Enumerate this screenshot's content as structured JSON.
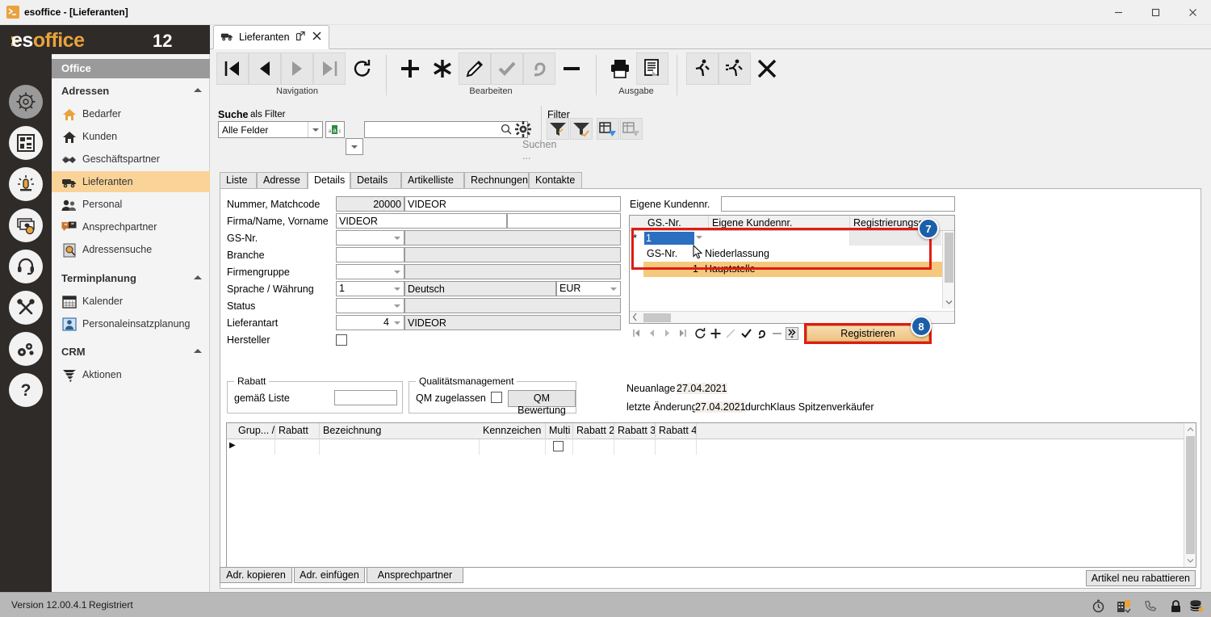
{
  "window": {
    "title": "esoffice - [Lieferanten]",
    "minimize": "minimize-icon",
    "maximize": "maximize-icon",
    "close": "close-icon"
  },
  "brand": {
    "name_es": "es",
    "name_office": "office",
    "version": "12"
  },
  "sidebar": {
    "header": "Office",
    "rail_icons": [
      "compass-icon",
      "layout-icon",
      "alarm-icon",
      "money-icon",
      "headset-icon",
      "tools-icon",
      "gears-icon",
      "help-icon"
    ],
    "groups": [
      {
        "label": "Adressen",
        "items": [
          {
            "label": "Bedarfer",
            "icon": "house-orange-icon"
          },
          {
            "label": "Kunden",
            "icon": "house-dark-icon"
          },
          {
            "label": "Geschäftspartner",
            "icon": "handshake-icon"
          },
          {
            "label": "Lieferanten",
            "icon": "truck-icon",
            "active": true
          },
          {
            "label": "Personal",
            "icon": "people-icon"
          },
          {
            "label": "Ansprechpartner",
            "icon": "quote-icon"
          },
          {
            "label": "Adressensuche",
            "icon": "address-search-icon"
          }
        ]
      },
      {
        "label": "Terminplanung",
        "items": [
          {
            "label": "Kalender",
            "icon": "calendar-icon"
          },
          {
            "label": "Personaleinsatzplanung",
            "icon": "staff-planning-icon"
          }
        ]
      },
      {
        "label": "CRM",
        "items": [
          {
            "label": "Aktionen",
            "icon": "tornado-icon"
          }
        ]
      }
    ]
  },
  "doc_tab": {
    "label": "Lieferanten",
    "icon": "truck-icon",
    "detach_icon": "popout-icon",
    "close_icon": "close-icon"
  },
  "toolbar": {
    "groups": [
      {
        "label": "Navigation",
        "buttons": [
          "first-record-icon",
          "prev-record-icon",
          "next-record-icon",
          "last-record-icon",
          "refresh-icon"
        ]
      },
      {
        "label": "Bearbeiten",
        "buttons": [
          "add-icon",
          "new-icon",
          "edit-icon",
          "confirm-icon",
          "undo-icon",
          "delete-icon"
        ]
      },
      {
        "label": "Ausgabe",
        "buttons": [
          "print-icon",
          "report-icon"
        ]
      },
      {
        "label": "",
        "buttons": [
          "run-icon",
          "run-fast-icon",
          "cancel-icon"
        ]
      }
    ]
  },
  "search": {
    "label": "Suche",
    "sublabel": "als Filter",
    "field_selector": "Alle Felder",
    "mode_icon": "abc-icon",
    "input_placeholder": "Suchen ...",
    "input_value": "",
    "search_icon": "search-icon",
    "settings_icon": "gear-icon"
  },
  "filter": {
    "label": "Filter",
    "buttons": [
      "filter-icon",
      "filter-check-icon",
      "filter-grid-icon",
      "filter-grid-off-icon"
    ]
  },
  "page_tabs": [
    {
      "label": "Liste",
      "active": false
    },
    {
      "label": "Adresse",
      "active": false
    },
    {
      "label": "Details",
      "active": true
    },
    {
      "label": "Details II",
      "active": false
    },
    {
      "label": "Artikelliste",
      "active": false
    },
    {
      "label": "Rechnungen",
      "active": false
    },
    {
      "label": "Kontakte",
      "active": false
    }
  ],
  "details_form": {
    "fields": [
      {
        "label": "Nummer, Matchcode",
        "value1": "20000",
        "value2": "VIDEOR"
      },
      {
        "label": "Firma/Name, Vorname",
        "value1": "VIDEOR",
        "value2": ""
      },
      {
        "label": "GS-Nr.",
        "value1": "",
        "value2": ""
      },
      {
        "label": "Branche",
        "value1": "",
        "value2": ""
      },
      {
        "label": "Firmengruppe",
        "value1": "",
        "value2": ""
      },
      {
        "label": "Sprache / Währung",
        "value1": "1",
        "value2": "Deutsch",
        "value3": "EUR"
      },
      {
        "label": "Status",
        "value1": "",
        "value2": ""
      },
      {
        "label": "Lieferantart",
        "value1": "4",
        "value2": "VIDEOR"
      },
      {
        "label": "Hersteller",
        "checkbox": true,
        "checked": false
      }
    ]
  },
  "customer_number_panel": {
    "label": "Eigene Kundennr.",
    "input_value": "",
    "columns": [
      "GS.-Nr.",
      "Eigene Kundennr.",
      "Registrierungssta"
    ],
    "editing_row": {
      "marker": "*",
      "gs_nr": "1",
      "kundennr": "",
      "status": ""
    },
    "dropdown": {
      "columns": [
        "GS-Nr.",
        "Niederlassung"
      ],
      "rows": [
        {
          "gs_nr": "1",
          "niederlassung": "Hauptstelle",
          "selected": true
        }
      ]
    },
    "nav_buttons": [
      "first-icon",
      "prev-icon",
      "next-icon",
      "last-icon",
      "refresh-icon",
      "add-icon",
      "edit-icon",
      "accept-icon",
      "undo-icon",
      "delete-icon",
      "more-icon"
    ],
    "register_button": "Registrieren",
    "callout_grid": "7",
    "callout_register": "8"
  },
  "rabatt_group": {
    "title": "Rabatt",
    "label": "gemäß Liste",
    "value": ""
  },
  "qm_group": {
    "title": "Qualitätsmanagement",
    "checkbox_label": "QM zugelassen",
    "checked": false,
    "button": "QM Bewertung"
  },
  "meta": {
    "created_label": "Neuanlage",
    "created_date": "27.04.2021",
    "changed_label": "letzte Änderung",
    "changed_date": "27.04.2021",
    "changed_by_label": "durch",
    "changed_by": "Klaus Spitzenverkäufer"
  },
  "discount_table": {
    "columns": [
      "Grup... /",
      "Rabatt",
      "Bezeichnung",
      "Kennzeichen",
      "Multi",
      "Rabatt 2",
      "Rabatt 3",
      "Rabatt 4"
    ],
    "rows": [
      {
        "marker": "▶",
        "grup": "",
        "rabatt": "",
        "bezeichnung": "",
        "kennzeichen": "",
        "multi": false,
        "rabatt2": "",
        "rabatt3": "",
        "rabatt4": ""
      }
    ],
    "nav_buttons": [
      "first-icon",
      "prev-icon",
      "next-icon",
      "last-icon",
      "refresh-icon",
      "add-icon",
      "edit-icon",
      "accept-icon",
      "undo-icon",
      "delete-icon"
    ],
    "rebate_button": "Artikel neu rabattieren"
  },
  "bottom_buttons": [
    "Adr. kopieren",
    "Adr. einfügen",
    "Ansprechpartner"
  ],
  "statusbar": {
    "version": "Version 12.00.4.1",
    "registered": "Registriert",
    "icons": [
      "timer-icon",
      "building-icon",
      "phone-icon",
      "lock-icon",
      "database-icon"
    ]
  },
  "colors": {
    "accent": "#e8a33d",
    "rail": "#2e2b29",
    "highlight": "#f9d397",
    "callout": "#1b5fa8",
    "redbox": "#e11b12"
  }
}
